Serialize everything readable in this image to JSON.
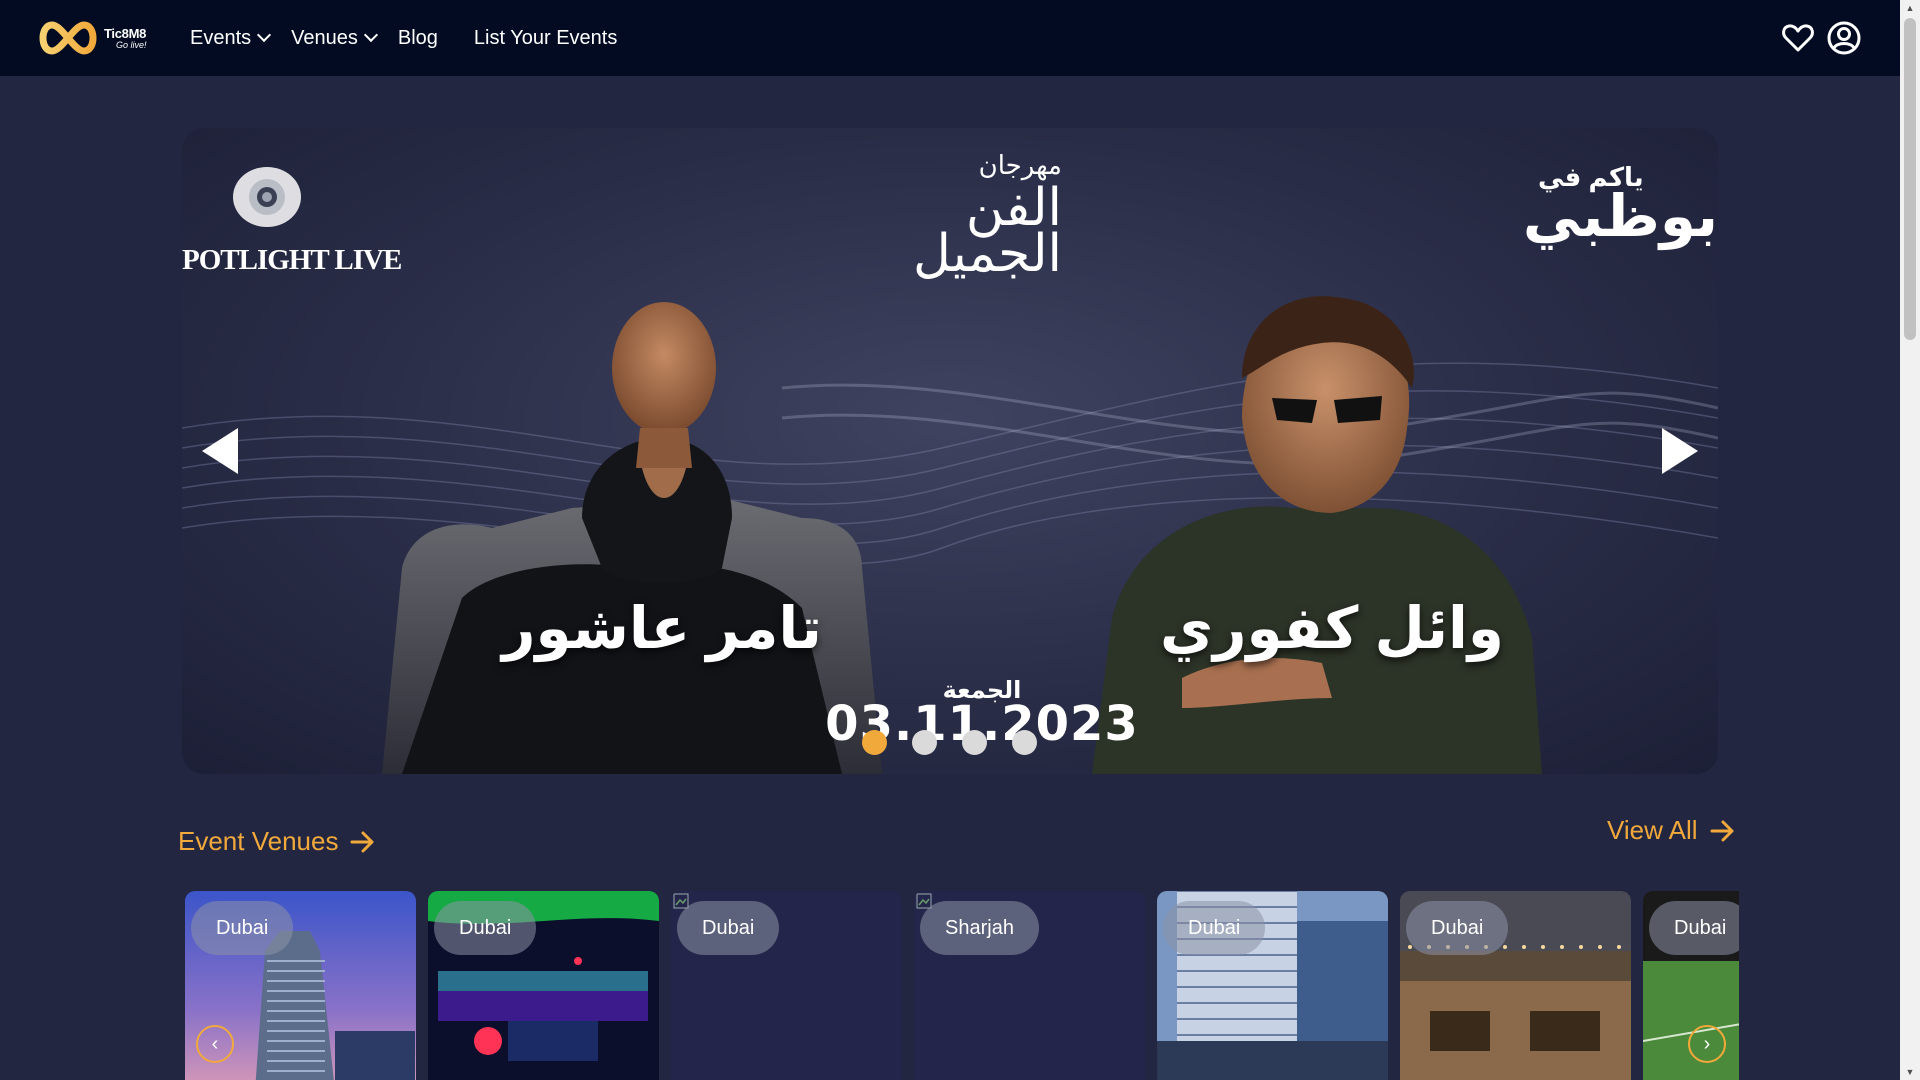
{
  "header": {
    "logo_brand": "Tic8M8",
    "logo_tagline": "Go live!",
    "nav": {
      "events": "Events",
      "venues": "Venues",
      "blog": "Blog",
      "list_events": "List Your Events"
    }
  },
  "hero": {
    "slides_count": 4,
    "active_slide": 1,
    "organizer": "POTLIGHT LIVE",
    "festival_line1": "مهرجان",
    "festival_line2": "الفن",
    "festival_line3": "الجميل",
    "location_line1": "ياكم في",
    "location_line2": "بوظبي",
    "artist_left": "تامر عاشور",
    "artist_right": "وائل كفوري",
    "day": "الجمعة",
    "date": "03.11.2023"
  },
  "venues_section": {
    "title": "Event Venues",
    "view_all": "View All",
    "cards": [
      {
        "city": "Dubai",
        "image": "tower"
      },
      {
        "city": "Dubai",
        "image": "club"
      },
      {
        "city": "Dubai",
        "image": "broken"
      },
      {
        "city": "Sharjah",
        "image": "broken"
      },
      {
        "city": "Dubai",
        "image": "building"
      },
      {
        "city": "Dubai",
        "image": "restaurant"
      },
      {
        "city": "Dubai",
        "image": "stadium"
      }
    ],
    "prev_glyph": "‹",
    "next_glyph": "›"
  },
  "colors": {
    "accent": "#f2a93b",
    "header_bg": "#020b22",
    "page_bg": "#222641"
  }
}
